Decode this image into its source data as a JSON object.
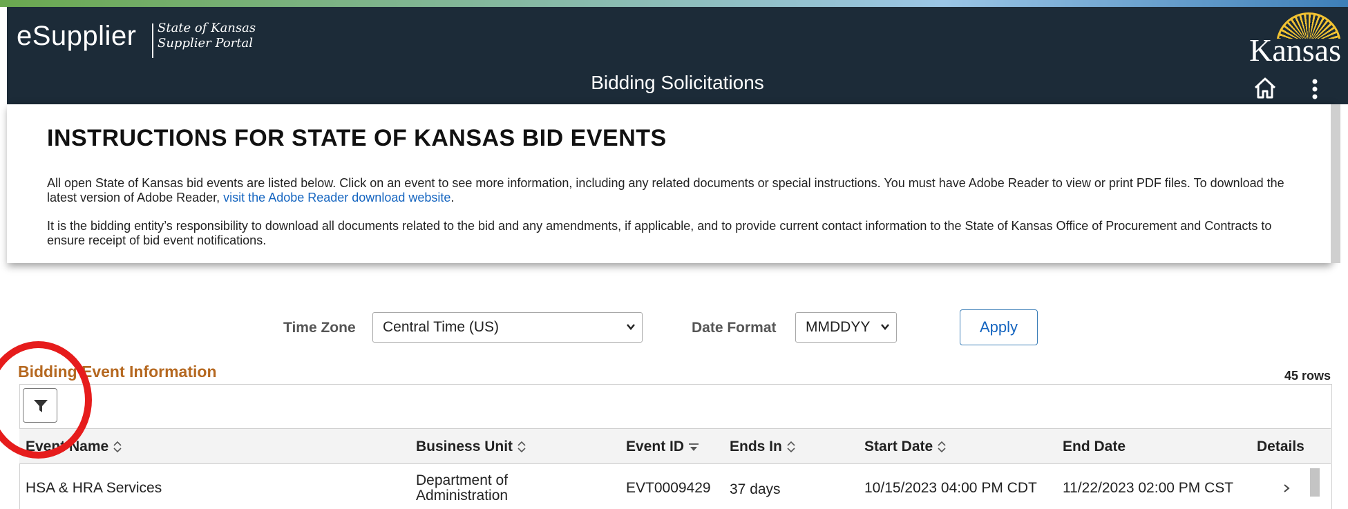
{
  "header": {
    "brand": "eSupplier",
    "brand_sub_line1": "State of Kansas",
    "brand_sub_line2": "Supplier Portal",
    "state_logo": "Kansas",
    "page_title": "Bidding Solicitations",
    "icons": {
      "home": "home-icon",
      "menu": "kebab-menu-icon"
    }
  },
  "instructions": {
    "title": "INSTRUCTIONS FOR STATE OF KANSAS BID EVENTS",
    "para1_text": "All open State of Kansas bid events are listed below. Click on an event to see more information, including any related documents or special instructions. You must have Adobe Reader to view or print PDF files. To download the latest version of Adobe Reader, ",
    "para1_link": "visit the Adobe Reader download website",
    "para1_end": ".",
    "para2": "It is the bidding entity’s responsibility to download all documents related to the bid and any amendments, if applicable, and to provide current contact information to the State of Kansas Office of Procurement and Contracts to ensure receipt of bid event notifications."
  },
  "filters": {
    "time_zone_label": "Time Zone",
    "time_zone_value": "Central Time (US)",
    "date_format_label": "Date Format",
    "date_format_value": "MMDDYY",
    "apply_label": "Apply"
  },
  "grid": {
    "title": "Bidding Event Information",
    "row_count": "45 rows",
    "columns": [
      {
        "label": "Event Name",
        "sort": "both"
      },
      {
        "label": "Business Unit",
        "sort": "both"
      },
      {
        "label": "Event ID",
        "sort": "desc"
      },
      {
        "label": "Ends In",
        "sort": "both"
      },
      {
        "label": "Start Date",
        "sort": "both"
      },
      {
        "label": "End Date",
        "sort": "none"
      },
      {
        "label": "Details",
        "sort": "none"
      }
    ],
    "rows": [
      {
        "event_name": "HSA & HRA Services",
        "business_unit_line1": "Department of",
        "business_unit_line2": "Administration",
        "event_id": "EVT0009429",
        "ends_in": "37 days",
        "start_date": "10/15/2023 04:00 PM CDT",
        "end_date": "11/22/2023 02:00 PM CST"
      }
    ]
  },
  "annotation": {
    "color": "#e61c1c"
  }
}
